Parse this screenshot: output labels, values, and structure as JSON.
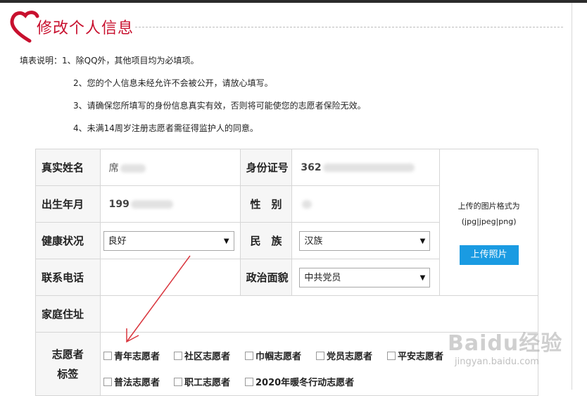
{
  "header": {
    "title": "修改个人信息"
  },
  "notes": [
    "填表说明：1、除QQ外，其他项目均为必填项。",
    "2、您的个人信息未经允许不会被公开，请放心填写。",
    "3、请确保您所填写的身份信息真实有效，否则将可能使您的志愿者保险无效。",
    "4、未满14周岁注册志愿者需征得监护人的同意。"
  ],
  "form": {
    "name_label": "真实姓名",
    "name_value": "席",
    "id_label": "身份证号",
    "id_value": "362",
    "birth_label": "出生年月",
    "birth_value": "199",
    "gender_label": "性　别",
    "health_label": "健康状况",
    "health_value": "良好",
    "ethnic_label": "民　族",
    "ethnic_value": "汉族",
    "phone_label": "联系电话",
    "political_label": "政治面貌",
    "political_value": "中共党员",
    "address_label": "家庭住址",
    "tags_label_1": "志愿者",
    "tags_label_2": "标签"
  },
  "photo": {
    "format_line1": "上传的图片格式为",
    "format_line2": "(jpg|jpeg|png)",
    "upload_button": "上传照片"
  },
  "tags": [
    "青年志愿者",
    "社区志愿者",
    "巾帼志愿者",
    "党员志愿者",
    "平安志愿者",
    "普法志愿者",
    "职工志愿者",
    "2020年暖冬行动志愿者"
  ],
  "watermark": {
    "brand": "Baidu经验",
    "url": "jingyan.baidu.com"
  },
  "colors": {
    "title": "#c8102e",
    "button": "#1a9be2",
    "arrow": "#d9363e"
  }
}
